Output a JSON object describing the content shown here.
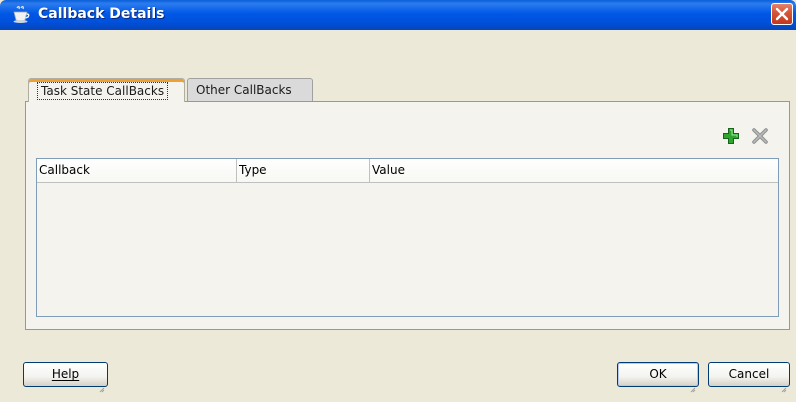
{
  "window": {
    "title": "Callback Details",
    "title_icon": "jdeveloper-cup-icon",
    "close_icon": "close-icon"
  },
  "tabs": [
    {
      "label": "Task State CallBacks",
      "selected": true
    },
    {
      "label": "Other CallBacks",
      "selected": false
    }
  ],
  "toolbar": {
    "add_icon": "add-icon",
    "delete_icon": "delete-icon"
  },
  "table": {
    "columns": [
      "Callback",
      "Type",
      "Value"
    ],
    "rows": []
  },
  "buttons": {
    "help": "Help",
    "ok": "OK",
    "cancel": "Cancel"
  },
  "colors": {
    "titlebar": "#0058E6",
    "dialog_bg": "#ECE9D8",
    "active_tab_accent": "#F0A030",
    "add_icon": "#2FA52F",
    "close_button": "#D7573A"
  }
}
